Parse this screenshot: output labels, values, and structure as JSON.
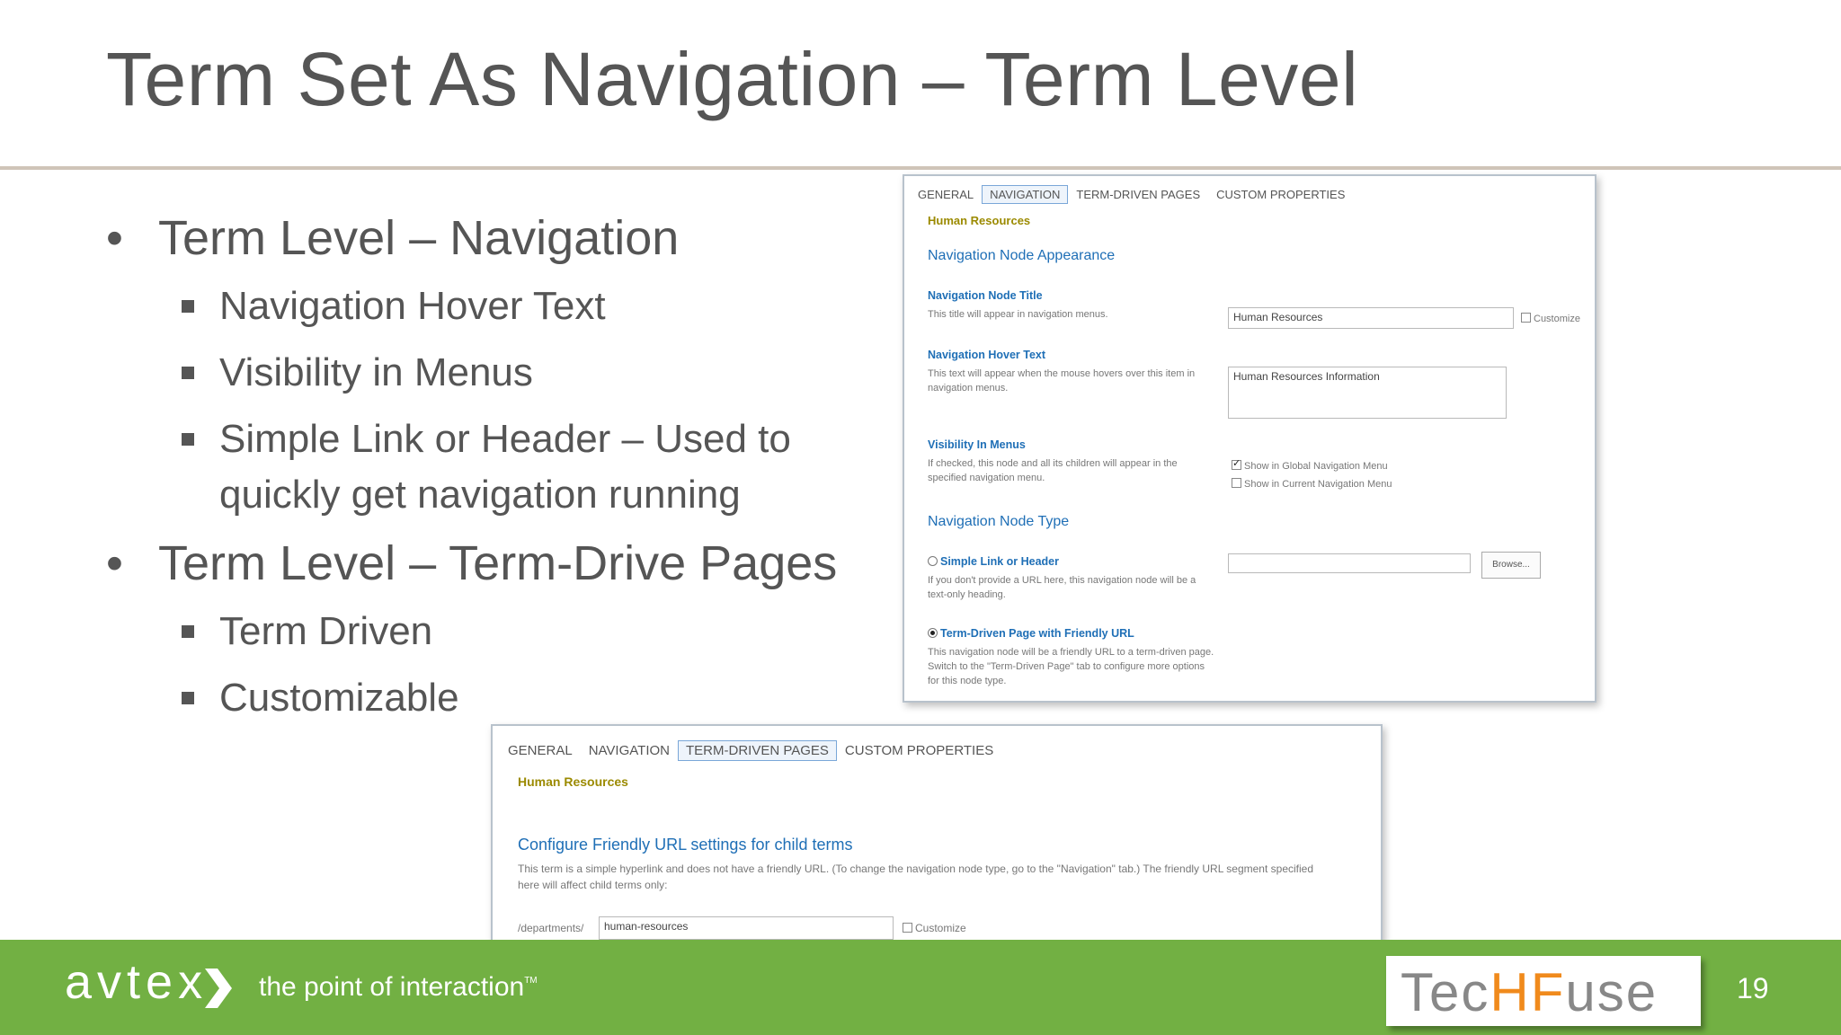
{
  "slide": {
    "title": "Term Set As Navigation – Term Level",
    "page_number": "19"
  },
  "bullets": [
    {
      "text": "Term Level – Navigation",
      "sub": [
        "Navigation Hover Text",
        "Visibility in Menus",
        "Simple Link or Header – Used to quickly get navigation running"
      ]
    },
    {
      "text": "Term Level – Term-Drive Pages",
      "sub": [
        "Term Driven",
        "Customizable"
      ]
    }
  ],
  "nav_panel": {
    "tabs": [
      "GENERAL",
      "NAVIGATION",
      "TERM-DRIVEN PAGES",
      "CUSTOM PROPERTIES"
    ],
    "active_tab": "NAVIGATION",
    "term_name": "Human Resources",
    "appearance_heading": "Navigation Node Appearance",
    "title_label": "Navigation Node Title",
    "title_desc": "This title will appear in navigation menus.",
    "title_value": "Human Resources",
    "customize_label": "Customize",
    "hover_label": "Navigation Hover Text",
    "hover_desc": "This text will appear when the mouse hovers over this item in navigation menus.",
    "hover_value": "Human Resources Information",
    "visibility_label": "Visibility In Menus",
    "visibility_desc": "If checked, this node and all its children will appear in the specified navigation menu.",
    "show_global": "Show in Global Navigation Menu",
    "show_current": "Show in Current Navigation Menu",
    "type_heading": "Navigation Node Type",
    "simple_link_label": "Simple Link or Header",
    "simple_link_desc": "If you don't provide a URL here, this navigation node will be a text-only heading.",
    "browse_label": "Browse...",
    "term_driven_label": "Term-Driven Page with Friendly URL",
    "term_driven_desc": "This navigation node will be a friendly URL to a term-driven page. Switch to the \"Term-Driven Page\" tab to configure more options for this node type."
  },
  "tdp_panel": {
    "tabs": [
      "GENERAL",
      "NAVIGATION",
      "TERM-DRIVEN PAGES",
      "CUSTOM PROPERTIES"
    ],
    "active_tab": "TERM-DRIVEN PAGES",
    "term_name": "Human Resources",
    "heading": "Configure Friendly URL settings for child terms",
    "desc": "This term is a simple hyperlink and does not have a friendly URL. (To change the navigation node type, go to the \"Navigation\" tab.) The friendly URL segment specified here will affect child terms only:",
    "url_prefix": "/departments/",
    "url_value": "human-resources",
    "customize_label": "Customize"
  },
  "footer": {
    "brand": "avtex",
    "tagline": "the point of interaction",
    "tm": "TM",
    "partner_logo_text": "TechFuse"
  },
  "colors": {
    "footer_green": "#72b043",
    "title_gray": "#555555",
    "link_blue": "#1f6fb6",
    "term_gold": "#9b8a00",
    "logo_orange": "#f08a1c"
  }
}
